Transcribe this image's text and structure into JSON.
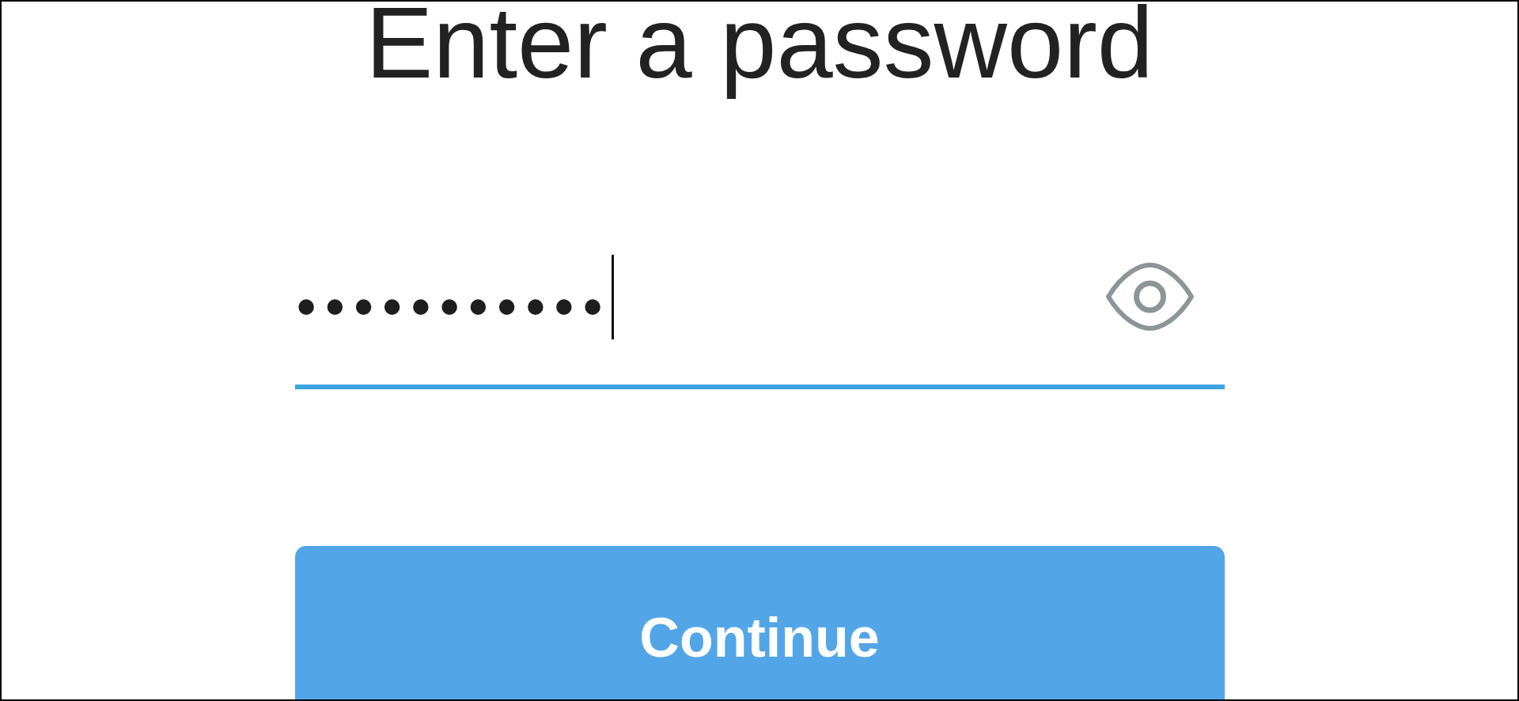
{
  "title": "Enter a password",
  "password_field": {
    "masked_value": "•••••••••••",
    "focused": true
  },
  "continue_button": {
    "label": "Continue"
  }
}
